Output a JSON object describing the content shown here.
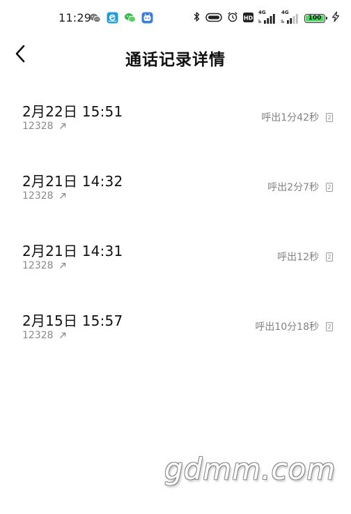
{
  "status_bar": {
    "time": "11:29",
    "network_1": "4G",
    "network_2": "4G",
    "battery": "100",
    "app_icons": [
      "wechat-icon",
      "browser-icon",
      "mini-program-icon",
      "bot-app-icon"
    ],
    "right_icons": [
      "bluetooth-icon",
      "toggle-icon",
      "alarm-icon",
      "hd-icon",
      "signal-icon",
      "signal-icon",
      "battery-icon",
      "charging-icon"
    ]
  },
  "header": {
    "title": "通话记录详情",
    "back_icon": "chevron-left-icon"
  },
  "calls": [
    {
      "datetime": "2月22日 15:51",
      "number": "12328",
      "duration": "呼出1分42秒",
      "sim": "2"
    },
    {
      "datetime": "2月21日 14:32",
      "number": "12328",
      "duration": "呼出2分7秒",
      "sim": "2"
    },
    {
      "datetime": "2月21日 14:31",
      "number": "12328",
      "duration": "呼出12秒",
      "sim": "2"
    },
    {
      "datetime": "2月15日 15:57",
      "number": "12328",
      "duration": "呼出10分18秒",
      "sim": "2"
    }
  ],
  "watermark": "gdmm.com",
  "colors": {
    "background": "#ffffff",
    "primary_text": "#111111",
    "secondary_text": "#888888",
    "battery_green": "#4cd964"
  }
}
